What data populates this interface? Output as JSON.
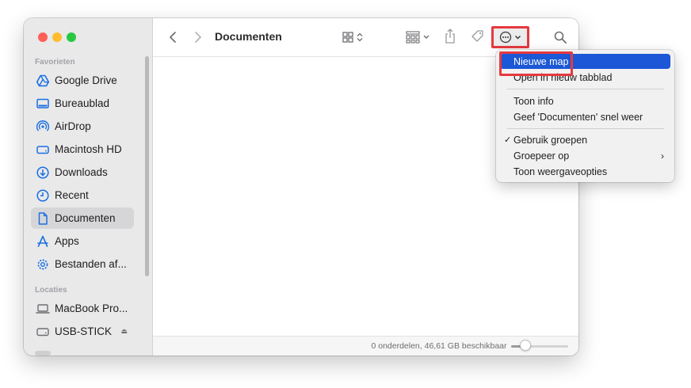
{
  "sidebar": {
    "favorites_title": "Favorieten",
    "locations_title": "Locaties",
    "favorites": [
      {
        "label": "Google Drive",
        "icon": "google-drive-icon"
      },
      {
        "label": "Bureaublad",
        "icon": "desktop-icon"
      },
      {
        "label": "AirDrop",
        "icon": "airdrop-icon"
      },
      {
        "label": "Macintosh HD",
        "icon": "hard-drive-icon"
      },
      {
        "label": "Downloads",
        "icon": "download-icon"
      },
      {
        "label": "Recent",
        "icon": "clock-icon"
      },
      {
        "label": "Documenten",
        "icon": "document-icon",
        "selected": true
      },
      {
        "label": "Apps",
        "icon": "apps-icon"
      },
      {
        "label": "Bestanden af...",
        "icon": "gear-icon"
      }
    ],
    "locations": [
      {
        "label": "MacBook Pro...",
        "icon": "laptop-icon"
      },
      {
        "label": "USB-STICK",
        "icon": "drive-icon"
      }
    ]
  },
  "toolbar": {
    "title": "Documenten"
  },
  "status": {
    "text": "0 onderdelen, 46,61 GB beschikbaar",
    "icon_size_level": 0.25
  },
  "menu": {
    "items_group1": [
      {
        "label": "Nieuwe map",
        "highlighted": true
      },
      {
        "label": "Open in nieuw tabblad"
      }
    ],
    "items_group2": [
      {
        "label": "Toon info"
      },
      {
        "label": "Geef 'Documenten' snel weer"
      }
    ],
    "items_group3": [
      {
        "label": "Gebruik groepen",
        "checked": true
      },
      {
        "label": "Groepeer op",
        "submenu": true
      },
      {
        "label": "Toon weergaveopties"
      }
    ],
    "check_glyph": "✓",
    "submenu_glyph": "›"
  },
  "colors": {
    "accent": "#1b57d6",
    "annotation": "#e6393f"
  }
}
